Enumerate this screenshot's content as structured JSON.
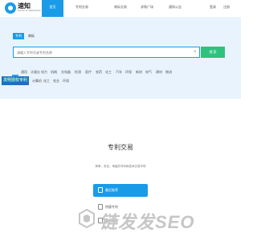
{
  "brand": {
    "name": "速知",
    "tagline": "SUZHI IP SERVICES"
  },
  "nav": {
    "items": [
      {
        "label": "首页",
        "active": true
      },
      {
        "label": "专利交易",
        "active": false
      },
      {
        "label": "商标交易",
        "active": false
      },
      {
        "label": "求购广场",
        "active": false
      },
      {
        "label": "通知公告",
        "active": false
      }
    ],
    "login": "登录",
    "register": "注册"
  },
  "search": {
    "tab_patent": "专利",
    "tab_trademark": "商标",
    "placeholder": "请输入专利号或专利名称",
    "clear_icon": "×",
    "button": "搜 索"
  },
  "categories": {
    "all": "全部",
    "row1": [
      "通用",
      "计量仪",
      "电力",
      "机械",
      "光电器",
      "检测",
      "医疗",
      "农药",
      "化工",
      "汽车",
      "环保",
      "新材",
      "电气",
      "建材",
      "物流"
    ],
    "row2": [
      "计算机",
      "化工",
      "农业",
      "环境"
    ]
  },
  "side_badge": "发明授权专利",
  "section": {
    "title": "专利交易",
    "subtitle": "简单、安全、海量的专利和技术交易市场",
    "menu": [
      "最近推荐",
      "特惠专利",
      "实用新型"
    ]
  },
  "watermark": "链发发SEO",
  "colors": {
    "primary": "#1a9be8",
    "search_button": "#2ec27e",
    "hero_bg": "#e9f3fd"
  }
}
